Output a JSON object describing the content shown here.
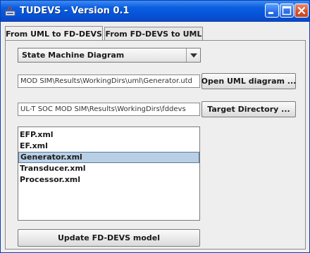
{
  "window": {
    "title": "TUDEVS - Version 0.1"
  },
  "tabs": [
    {
      "label": "From UML to FD-DEVS",
      "active": true
    },
    {
      "label": "From FD-DEVS to UML",
      "active": false
    }
  ],
  "main": {
    "diagram_type": {
      "selected": "State Machine Diagram"
    },
    "uml_path": {
      "value": "MOD SIM\\Results\\WorkingDirs\\uml\\Generator.utd"
    },
    "open_button": "Open UML diagram ...",
    "target_path": {
      "value": "UL-T SOC MOD SIM\\Results\\WorkingDirs\\fddevs"
    },
    "target_button": "Target Directory ...",
    "files": [
      {
        "label": "EFP.xml",
        "selected": false
      },
      {
        "label": "EF.xml",
        "selected": false
      },
      {
        "label": "Generator.xml",
        "selected": true
      },
      {
        "label": "Transducer.xml",
        "selected": false
      },
      {
        "label": "Processor.xml",
        "selected": false
      }
    ],
    "update_button": "Update FD-DEVS model"
  },
  "colors": {
    "titlebar": "#0553d8",
    "selection": "#b8cfe5",
    "panel": "#eeeeee"
  }
}
